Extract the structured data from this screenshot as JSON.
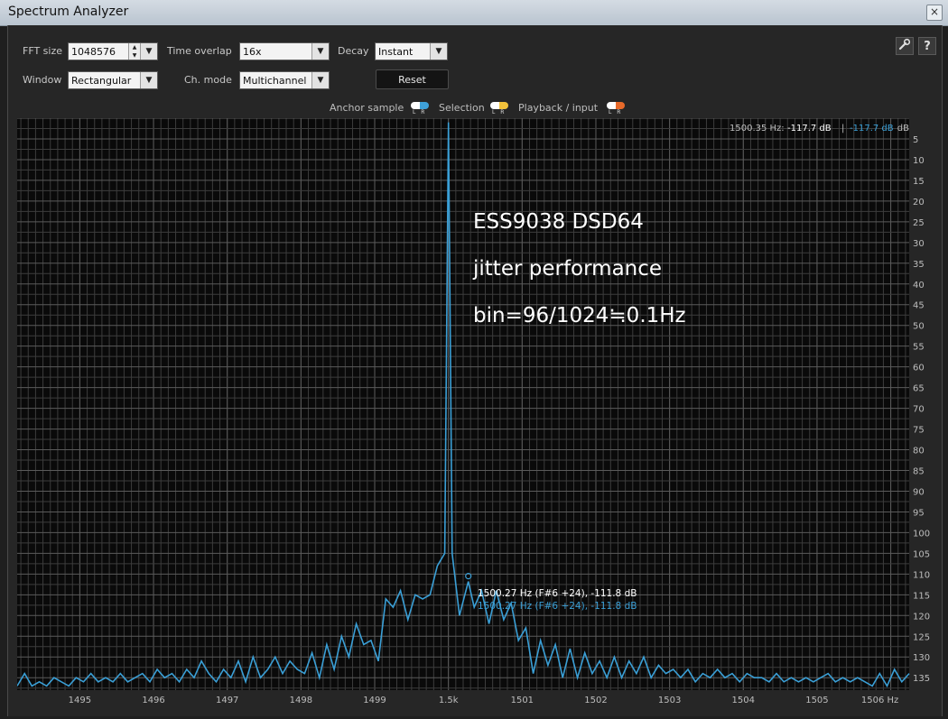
{
  "window": {
    "title": "Spectrum Analyzer",
    "close_glyph": "×"
  },
  "toolbar": {
    "fft_size": {
      "label": "FFT size",
      "value": "1048576"
    },
    "time_overlap": {
      "label": "Time overlap",
      "value": "16x"
    },
    "decay": {
      "label": "Decay",
      "value": "Instant"
    },
    "window_fn": {
      "label": "Window",
      "value": "Rectangular"
    },
    "ch_mode": {
      "label": "Ch. mode",
      "value": "Multichannel"
    },
    "reset_label": "Reset",
    "settings_icon": "wrench-icon",
    "help_glyph": "?"
  },
  "legend": {
    "anchor": "Anchor sample",
    "selection": "Selection",
    "playback": "Playback / input",
    "lr": "L R",
    "colors": {
      "anchor_l": "#ffffff",
      "anchor_r": "#3ea0d8",
      "sel_l": "#ffffff",
      "sel_r": "#f2c23b",
      "play_l": "#ffffff",
      "play_r": "#e86a2a"
    }
  },
  "readout": {
    "freq": "1500.35 Hz:",
    "left_db": "-117.7 dB",
    "sep": "|",
    "right_db": "-117.7 dB"
  },
  "cursor": {
    "line1": "1500.27 Hz (F#6 +24), -111.8 dB",
    "line2": "1500.27 Hz (F#6 +24), -111.8 dB"
  },
  "annotation": {
    "line1": "ESS9038  DSD64",
    "line2": "jitter performance",
    "line3": "bin=96/1024≒0.1Hz"
  },
  "colors": {
    "trace": "#3a9fd6",
    "grid": "#3c3c3c",
    "grid_major": "#5a5a5a",
    "plot_bg": "#0a0a0a"
  },
  "chart_data": {
    "type": "line",
    "x_unit": "Hz",
    "y_unit": "dB",
    "xlim": [
      1494.15,
      1506.25
    ],
    "ylim": [
      0,
      -138
    ],
    "x_ticks": [
      "1495",
      "1496",
      "1497",
      "1498",
      "1499",
      "1.5k",
      "1501",
      "1502",
      "1503",
      "1504",
      "1505",
      "1506 Hz"
    ],
    "x_tick_values": [
      1495,
      1496,
      1497,
      1498,
      1499,
      1500,
      1501,
      1502,
      1503,
      1504,
      1505,
      1506
    ],
    "y_unit_label": "dB",
    "y_ticks": [
      "5",
      "10",
      "15",
      "20",
      "25",
      "30",
      "35",
      "40",
      "45",
      "50",
      "55",
      "60",
      "65",
      "70",
      "75",
      "80",
      "85",
      "90",
      "95",
      "100",
      "105",
      "110",
      "115",
      "120",
      "125",
      "130",
      "135"
    ],
    "y_tick_values": [
      -5,
      -10,
      -15,
      -20,
      -25,
      -30,
      -35,
      -40,
      -45,
      -50,
      -55,
      -60,
      -65,
      -70,
      -75,
      -80,
      -85,
      -90,
      -95,
      -100,
      -105,
      -110,
      -115,
      -120,
      -125,
      -130,
      -135
    ],
    "series": [
      {
        "x": [
          1494.15,
          1494.25,
          1494.35,
          1494.45,
          1494.55,
          1494.65,
          1494.75,
          1494.85,
          1494.95,
          1495.05,
          1495.15,
          1495.25,
          1495.35,
          1495.45,
          1495.55,
          1495.65,
          1495.75,
          1495.85,
          1495.95,
          1496.05,
          1496.15,
          1496.25,
          1496.35,
          1496.45,
          1496.55,
          1496.65,
          1496.75,
          1496.85,
          1496.95,
          1497.05,
          1497.15,
          1497.25,
          1497.35,
          1497.45,
          1497.55,
          1497.65,
          1497.75,
          1497.85,
          1497.95,
          1498.05,
          1498.15,
          1498.25,
          1498.35,
          1498.45,
          1498.55,
          1498.65,
          1498.75,
          1498.85,
          1498.95,
          1499.05,
          1499.15,
          1499.25,
          1499.35,
          1499.45,
          1499.55,
          1499.65,
          1499.75,
          1499.85,
          1499.95,
          1500.0,
          1500.05,
          1500.15,
          1500.27,
          1500.35,
          1500.45,
          1500.55,
          1500.65,
          1500.75,
          1500.85,
          1500.95,
          1501.05,
          1501.15,
          1501.25,
          1501.35,
          1501.45,
          1501.55,
          1501.65,
          1501.75,
          1501.85,
          1501.95,
          1502.05,
          1502.15,
          1502.25,
          1502.35,
          1502.45,
          1502.55,
          1502.65,
          1502.75,
          1502.85,
          1502.95,
          1503.05,
          1503.15,
          1503.25,
          1503.35,
          1503.45,
          1503.55,
          1503.65,
          1503.75,
          1503.85,
          1503.95,
          1504.05,
          1504.15,
          1504.25,
          1504.35,
          1504.45,
          1504.55,
          1504.65,
          1504.75,
          1504.85,
          1504.95,
          1505.05,
          1505.15,
          1505.25,
          1505.35,
          1505.45,
          1505.55,
          1505.65,
          1505.75,
          1505.85,
          1505.95,
          1506.05,
          1506.15,
          1506.25
        ],
        "y": [
          -137,
          -134,
          -137,
          -136,
          -137,
          -135,
          -136,
          -137,
          -135,
          -136,
          -134,
          -136,
          -135,
          -136,
          -134,
          -136,
          -135,
          -134,
          -136,
          -133,
          -135,
          -134,
          -136,
          -133,
          -135,
          -131,
          -134,
          -136,
          -133,
          -135,
          -131,
          -136,
          -130,
          -135,
          -133,
          -130,
          -134,
          -131,
          -133,
          -134,
          -129,
          -135,
          -127,
          -133,
          -125,
          -130,
          -122,
          -127,
          -126,
          -131,
          -116,
          -118,
          -114,
          -121,
          -115,
          -116,
          -115,
          -108,
          -105,
          -1,
          -105,
          -120,
          -111.8,
          -118,
          -114,
          -122,
          -114,
          -121,
          -117,
          -126,
          -123,
          -134,
          -126,
          -132,
          -127,
          -135,
          -128,
          -135,
          -129,
          -134,
          -131,
          -135,
          -130,
          -135,
          -131,
          -134,
          -130,
          -135,
          -132,
          -134,
          -133,
          -135,
          -133,
          -136,
          -134,
          -135,
          -133,
          -135,
          -134,
          -136,
          -134,
          -135,
          -135,
          -136,
          -134,
          -136,
          -135,
          -136,
          -135,
          -136,
          -135,
          -134,
          -136,
          -135,
          -136,
          -135,
          -136,
          -137,
          -134,
          -137,
          -133,
          -136,
          -134
        ]
      }
    ]
  }
}
